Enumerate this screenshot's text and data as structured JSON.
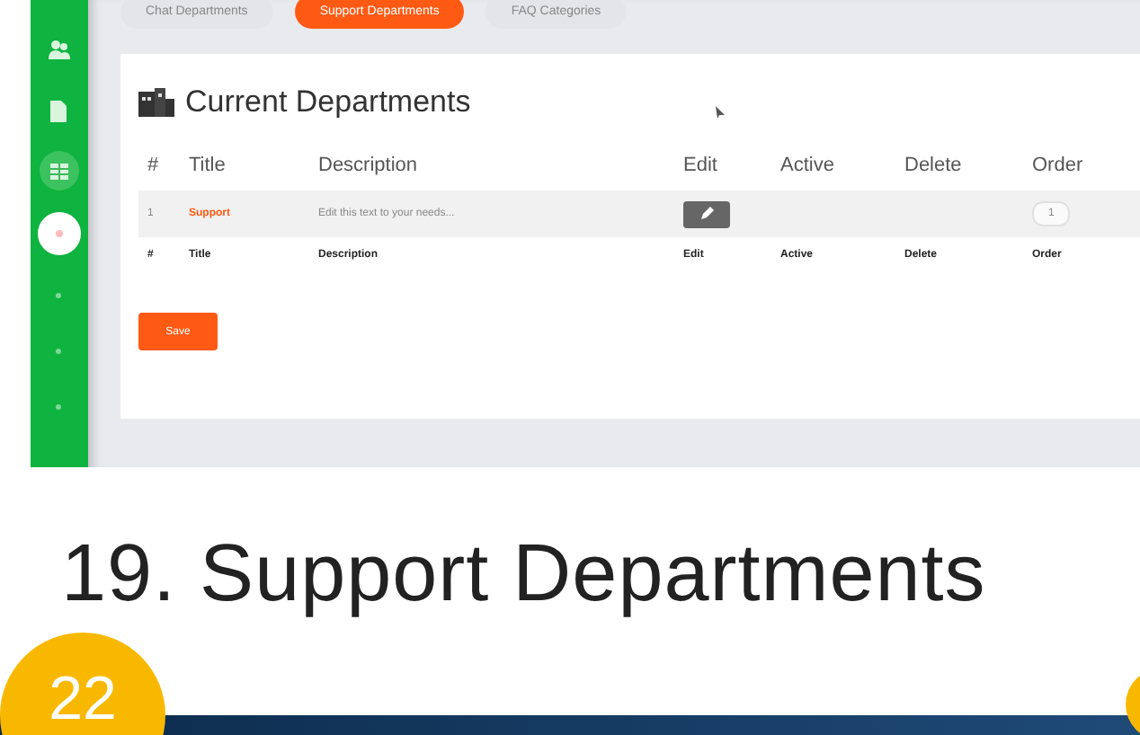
{
  "tabs": [
    {
      "label": "Chat Departments",
      "selected": false
    },
    {
      "label": "Support Departments",
      "selected": true
    },
    {
      "label": "FAQ Categories",
      "selected": false
    }
  ],
  "sidebar": {
    "items": [
      {
        "kind": "users",
        "selected": false
      },
      {
        "kind": "document",
        "selected": false
      },
      {
        "kind": "grid",
        "selected": false
      },
      {
        "kind": "circle",
        "selected": true
      },
      {
        "kind": "dot",
        "selected": false
      },
      {
        "kind": "dot",
        "selected": false
      },
      {
        "kind": "dot",
        "selected": false
      }
    ]
  },
  "card": {
    "title": "Current Departments",
    "columns": [
      "#",
      "Title",
      "Description",
      "Edit",
      "Active",
      "Delete",
      "Order"
    ],
    "rows": [
      {
        "number": "1",
        "title": "Support",
        "description": "Edit this text to your needs...",
        "order": "1"
      }
    ],
    "footer_columns": [
      "#",
      "Title",
      "Description",
      "Edit",
      "Active",
      "Delete",
      "Order"
    ],
    "save_button": "Save"
  },
  "heading": "19. Support Departments",
  "badge": "22"
}
